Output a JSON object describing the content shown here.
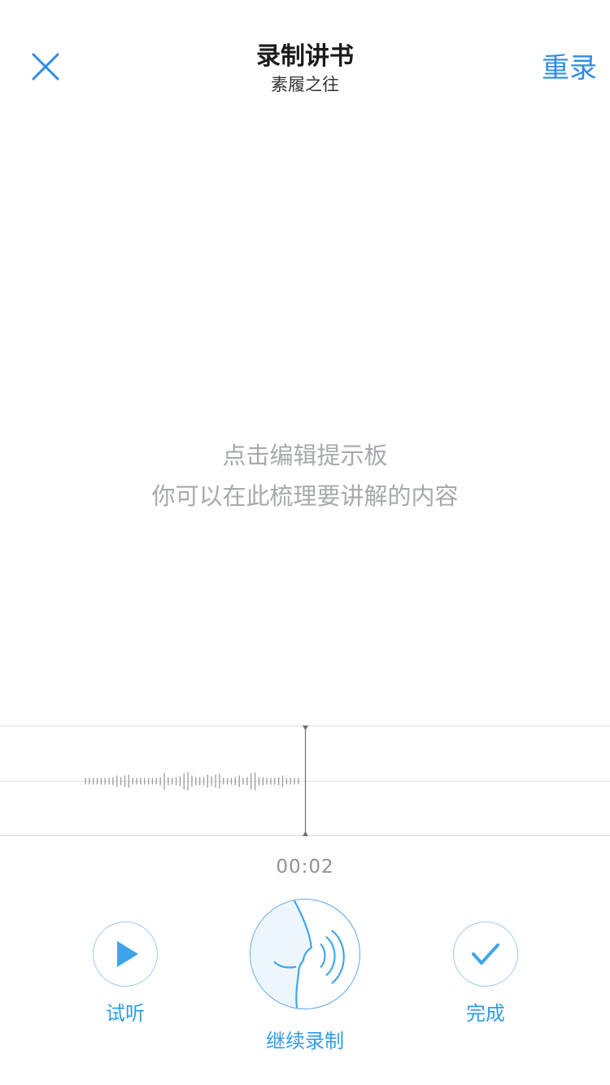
{
  "header": {
    "title": "录制讲书",
    "subtitle": "素履之往",
    "rerecord_label": "重录",
    "close_icon": "close-icon"
  },
  "prompt_board": {
    "line1": "点击编辑提示板",
    "line2": "你可以在此梳理要讲解的内容"
  },
  "recording": {
    "elapsed_time": "00:02"
  },
  "controls": {
    "preview_label": "试听",
    "record_label": "继续录制",
    "done_label": "完成",
    "preview_icon": "play-icon",
    "record_icon": "speaking-face-icon",
    "done_icon": "checkmark-icon"
  },
  "colors": {
    "accent": "#2e8ce6",
    "button_accent": "#3fa5e8",
    "hint_text": "#a6a9ae",
    "wave": "#9a9a9a"
  }
}
